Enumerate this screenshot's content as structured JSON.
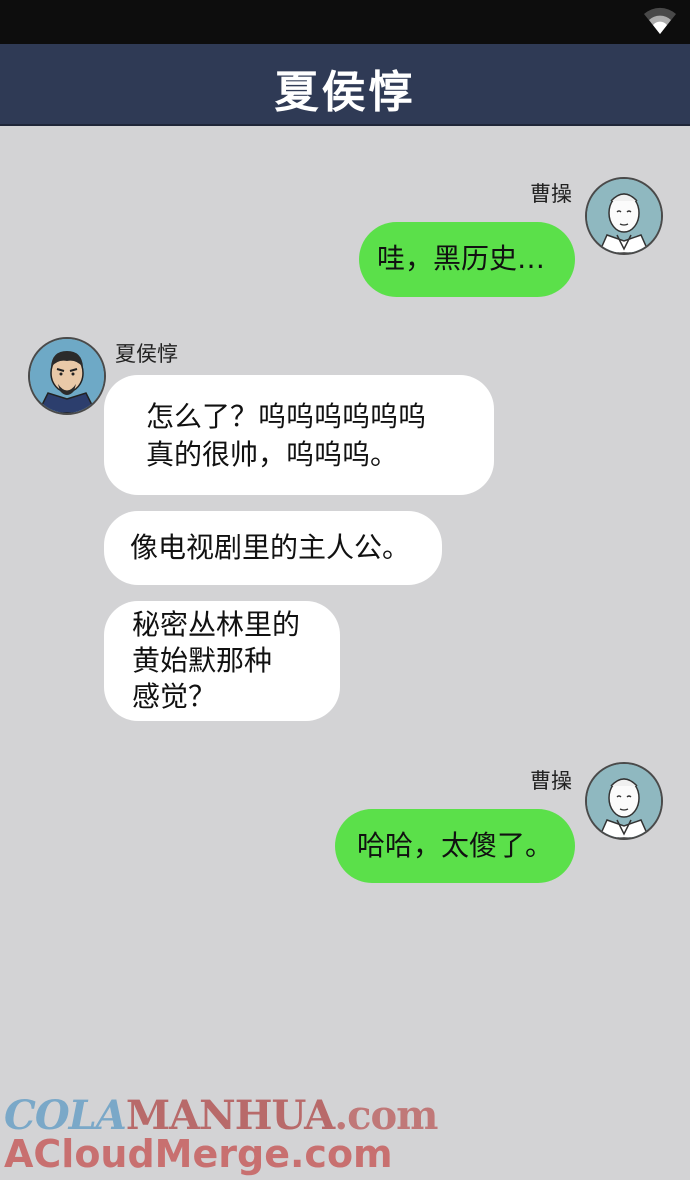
{
  "header": {
    "title": "夏侯惇"
  },
  "messages": [
    {
      "sender": "曹操",
      "side": "right",
      "text": "哇，黑历史…"
    },
    {
      "sender": "夏侯惇",
      "side": "left",
      "text": "怎么了？呜呜呜呜呜呜\n真的很帅，呜呜呜。"
    },
    {
      "side": "left",
      "text": "像电视剧里的主人公。"
    },
    {
      "side": "left",
      "text": "秘密丛林里的\n黄始默那种\n感觉？"
    },
    {
      "sender": "曹操",
      "side": "right",
      "text": "哈哈，太傻了。"
    }
  ],
  "colors": {
    "header_bg": "#2f3a55",
    "outgoing_bubble": "#5be04a",
    "incoming_bubble": "#ffffff",
    "background": "#d3d3d5"
  },
  "icons": {
    "status": "wifi-icon"
  },
  "watermark": {
    "line1_a": "COLA",
    "line1_b": "MANHUA",
    "line1_c": ".com",
    "line2": "ACloudMerge.com"
  }
}
